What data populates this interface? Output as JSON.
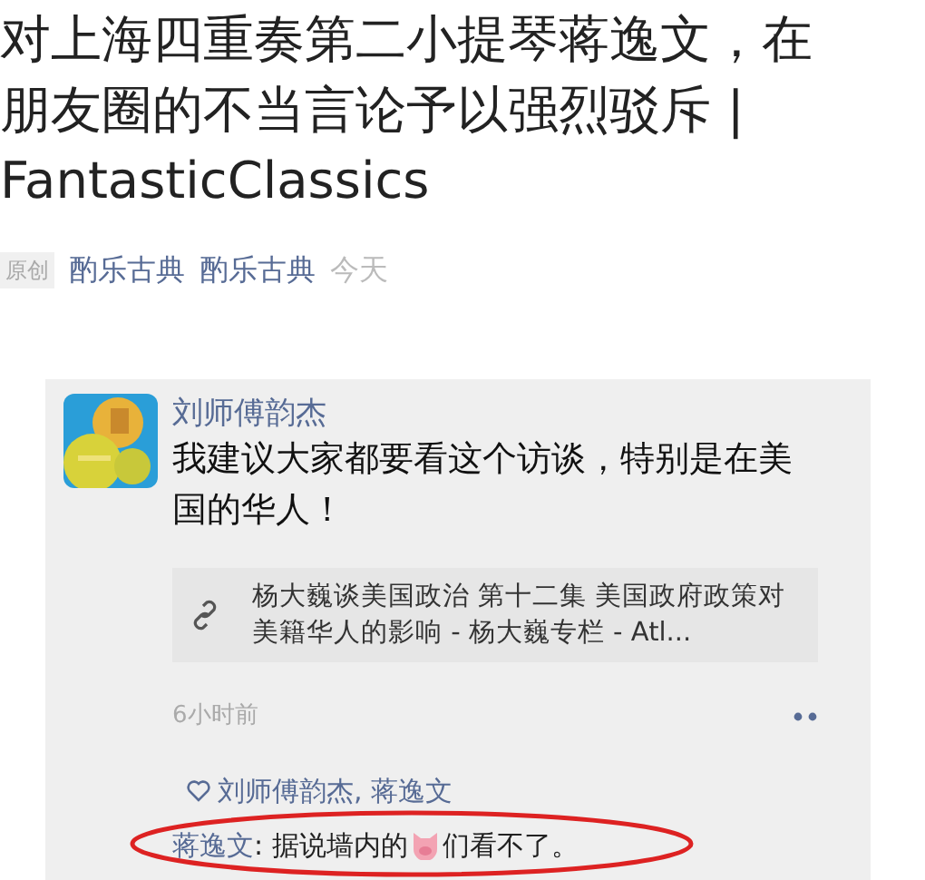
{
  "article": {
    "title": "对上海四重奏第二小提琴蒋逸文，在朋友圈的不当言论予以强烈驳斥 | FantasticClassics",
    "original_tag": "原创",
    "author": "酌乐古典",
    "account": "酌乐古典",
    "date": "今天"
  },
  "post": {
    "name": "刘师傅韵杰",
    "text": "我建议大家都要看这个访谈，特别是在美国的华人！",
    "link_title": "杨大巍谈美国政治 第十二集 美国政府政策对美籍华人的影响 - 杨大巍专栏 - Atl...",
    "time": "6小时前",
    "likes": "刘师傅韵杰, 蒋逸文",
    "comments": [
      {
        "author": "蒋逸文",
        "text_before": ": 据说墙内的",
        "text_after": "们看不了。",
        "highlighted": true
      }
    ]
  }
}
